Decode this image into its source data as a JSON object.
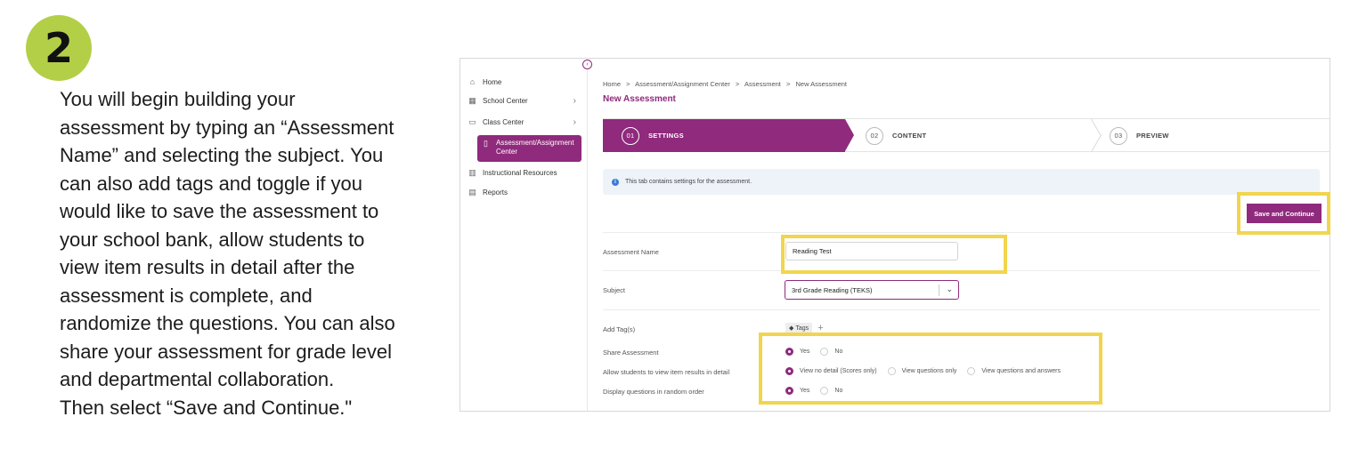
{
  "step": {
    "number": "2",
    "badge_color": "#b3cf48"
  },
  "instructions": [
    "You will begin building your",
    "assessment by typing an “Assessment",
    "Name” and selecting the subject. You",
    "can also add tags and toggle if you",
    "would like to save the assessment to",
    "your school bank, allow students to",
    "view item results in detail after the",
    "assessment is complete, and",
    "randomize the questions. You can also",
    "share your assessment  for grade level",
    "and departmental collaboration.",
    "Then select “Save and Continue.\""
  ],
  "sidebar": {
    "items": [
      {
        "label": "Home",
        "icon": "home-icon",
        "has_chevron": false
      },
      {
        "label": "School Center",
        "icon": "school-icon",
        "has_chevron": true
      },
      {
        "label": "Class Center",
        "icon": "class-icon",
        "has_chevron": true
      },
      {
        "label": "Assessment/Assignment Center",
        "icon": "book-icon",
        "has_chevron": false,
        "active": true
      },
      {
        "label": "Instructional Resources",
        "icon": "open-book-icon",
        "has_chevron": false
      },
      {
        "label": "Reports",
        "icon": "report-icon",
        "has_chevron": false
      }
    ]
  },
  "breadcrumb": [
    "Home",
    ">",
    "Assessment/Assignment Center",
    ">",
    "Assessment",
    ">",
    "New Assessment"
  ],
  "page_title": "New Assessment",
  "steps": [
    {
      "num": "01",
      "label": "SETTINGS",
      "active": true
    },
    {
      "num": "02",
      "label": "CONTENT",
      "active": false
    },
    {
      "num": "03",
      "label": "PREVIEW",
      "active": false
    }
  ],
  "info_text": "This tab contains settings for the assessment.",
  "save_button": "Save and Continue",
  "form": {
    "assessment_name_label": "Assessment Name",
    "assessment_name_value": "Reading Test",
    "subject_label": "Subject",
    "subject_value": "3rd Grade Reading (TEKS)",
    "tags_label": "Add Tag(s)",
    "tags_button": "Tags",
    "share_label": "Share Assessment",
    "share_options": [
      "Yes",
      "No"
    ],
    "share_selected": "Yes",
    "view_results_label": "Allow students to view item results in detail",
    "view_results_options": [
      "View no detail (Scores only)",
      "View questions only",
      "View questions and answers"
    ],
    "view_results_selected": "View no detail (Scores only)",
    "random_label": "Display questions in random order",
    "random_options": [
      "Yes",
      "No"
    ],
    "random_selected": "Yes"
  },
  "colors": {
    "accent": "#8f2a7c",
    "highlight": "#f1d54d",
    "info_bg": "#eef3fa"
  }
}
